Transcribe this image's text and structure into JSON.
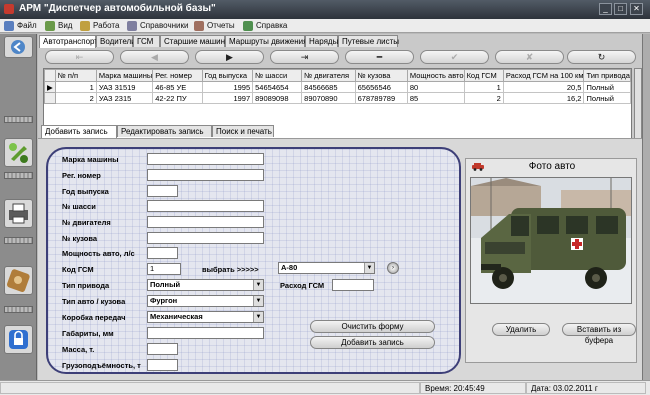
{
  "window": {
    "title": "АРМ \"Диспетчер автомобильной базы\""
  },
  "menu": [
    {
      "label": "Файл",
      "icon": "file-icon",
      "color": "#5a7fbf"
    },
    {
      "label": "Вид",
      "icon": "view-icon",
      "color": "#6a9a4a"
    },
    {
      "label": "Работа",
      "icon": "work-icon",
      "color": "#c0a040"
    },
    {
      "label": "Справочники",
      "icon": "reference-icon",
      "color": "#7f7f9f"
    },
    {
      "label": "Отчеты",
      "icon": "report-icon",
      "color": "#9f6f5f"
    },
    {
      "label": "Справка",
      "icon": "help-icon",
      "color": "#4f8f4f"
    }
  ],
  "main_tabs": [
    "Автотранспорт",
    "Водители",
    "ГСМ",
    "Старшие машин",
    "Маршруты движения",
    "Наряды",
    "Путевые листы"
  ],
  "nav_buttons": [
    {
      "glyph": "⇤",
      "name": "first-record-button",
      "disabled": true
    },
    {
      "glyph": "◀",
      "name": "prev-record-button",
      "disabled": true
    },
    {
      "glyph": "▶",
      "name": "next-record-button",
      "disabled": false
    },
    {
      "glyph": "⇥",
      "name": "last-record-button",
      "disabled": false
    },
    {
      "glyph": "━",
      "name": "delete-record-button",
      "disabled": false
    },
    {
      "glyph": "✔",
      "name": "post-record-button",
      "disabled": true
    },
    {
      "glyph": "✘",
      "name": "cancel-record-button",
      "disabled": true
    },
    {
      "glyph": "↻",
      "name": "refresh-button",
      "disabled": false
    }
  ],
  "grid": {
    "columns": [
      "№ п/п",
      "Марка машины",
      "Рег. номер",
      "Год выпуска",
      "№ шасси",
      "№ двигателя",
      "№ кузова",
      "Мощность авто",
      "Код ГСМ",
      "Расход ГСМ на 100 км",
      "Тип привода"
    ],
    "rows": [
      [
        "1",
        "УАЗ 31519",
        "46-85 УЕ",
        "1995",
        "54654654",
        "84566685",
        "65656546",
        "80",
        "1",
        "20,5",
        "Полный"
      ],
      [
        "2",
        "УАЗ 2315",
        "42-22 ПУ",
        "1997",
        "89089098",
        "89070890",
        "678789789",
        "85",
        "2",
        "16,2",
        "Полный"
      ]
    ]
  },
  "sub_tabs": [
    "Добавить запись",
    "Редактировать запись",
    "Поиск и печать"
  ],
  "form": {
    "fields": [
      {
        "label": "Марка машины",
        "value": ""
      },
      {
        "label": "Рег. номер",
        "value": ""
      },
      {
        "label": "Год выпуска",
        "value": ""
      },
      {
        "label": "№ шасси",
        "value": ""
      },
      {
        "label": "№ двигателя",
        "value": ""
      },
      {
        "label": "№ кузова",
        "value": ""
      },
      {
        "label": "Мощность авто, л/с",
        "value": ""
      },
      {
        "label": "Код ГСМ",
        "value": "1"
      },
      {
        "label": "Тип привода",
        "value": "Полный"
      },
      {
        "label": "Тип авто / кузова",
        "value": "Фургон"
      },
      {
        "label": "Коробка передач",
        "value": "Механическая"
      },
      {
        "label": "Габариты, мм",
        "value": ""
      },
      {
        "label": "Масса, т.",
        "value": ""
      },
      {
        "label": "Грузоподъёмность, т",
        "value": ""
      }
    ],
    "choose_label": "выбрать >>>>>",
    "fuel_value": "А-80",
    "fuel_consumption_label": "Расход ГСМ",
    "fuel_consumption_value": "",
    "clear_button": "Очистить форму",
    "add_button": "Добавить запись"
  },
  "photo": {
    "title": "Фото авто",
    "delete_button": "Удалить",
    "paste_button": "Вставить из буфера"
  },
  "status": {
    "time_label": "Время: 20:45:49",
    "date_label": "Дата: 03.02.2011 г"
  }
}
